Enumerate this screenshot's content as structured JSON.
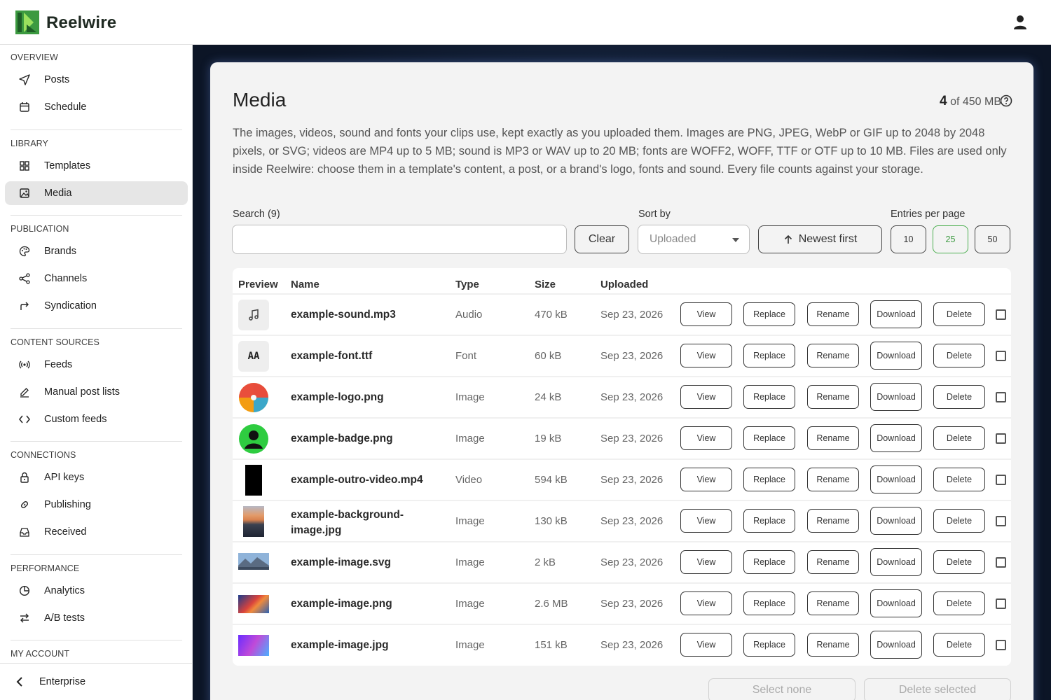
{
  "app": {
    "name": "Reelwire",
    "brand_color": "#3c9a40"
  },
  "header": {
    "user_icon": "user-icon"
  },
  "sidebar": {
    "sections": [
      {
        "title": "OVERVIEW",
        "items": [
          {
            "label": "Posts",
            "icon": "send-icon"
          },
          {
            "label": "Schedule",
            "icon": "calendar-icon"
          }
        ]
      },
      {
        "title": "LIBRARY",
        "items": [
          {
            "label": "Templates",
            "icon": "grid-icon"
          },
          {
            "label": "Media",
            "icon": "image-icon",
            "active": true
          }
        ]
      },
      {
        "title": "PUBLICATION",
        "items": [
          {
            "label": "Brands",
            "icon": "palette-icon"
          },
          {
            "label": "Channels",
            "icon": "share-icon"
          },
          {
            "label": "Syndication",
            "icon": "forward-arrow-icon"
          }
        ]
      },
      {
        "title": "CONTENT SOURCES",
        "items": [
          {
            "label": "Feeds",
            "icon": "broadcast-icon"
          },
          {
            "label": "Manual post lists",
            "icon": "pencil-icon"
          },
          {
            "label": "Custom feeds",
            "icon": "code-icon"
          }
        ]
      },
      {
        "title": "CONNECTIONS",
        "items": [
          {
            "label": "API keys",
            "icon": "lock-icon"
          },
          {
            "label": "Publishing",
            "icon": "link-icon"
          },
          {
            "label": "Received",
            "icon": "inbox-icon"
          }
        ]
      },
      {
        "title": "PERFORMANCE",
        "items": [
          {
            "label": "Analytics",
            "icon": "pie-chart-icon"
          },
          {
            "label": "A/B tests",
            "icon": "swap-icon"
          }
        ]
      },
      {
        "title": "MY ACCOUNT",
        "items": []
      }
    ],
    "bottom": {
      "label": "Enterprise",
      "icon": "chevron-left-icon"
    }
  },
  "main": {
    "title": "Media",
    "storage": {
      "used": "4",
      "rest": " of 450 MB"
    },
    "description": "The images, videos, sound and fonts your clips use, kept exactly as you uploaded them. Images are PNG, JPEG, WebP or GIF up to 2048 by 2048 pixels, or SVG; videos are MP4 up to 5 MB; sound is MP3 or WAV up to 20 MB; fonts are WOFF2, WOFF, TTF or OTF up to 10 MB. Files are used only inside Reelwire: choose them in a template's content, a post, or a brand's logo, fonts and sound. Every file counts against your storage.",
    "search": {
      "label": "Search (9)",
      "value": "",
      "placeholder": ""
    },
    "clear_label": "Clear",
    "sort": {
      "label": "Sort by",
      "selected": "Uploaded",
      "order_label": "Newest first"
    },
    "entries": {
      "label": "Entries per page",
      "options": [
        "10",
        "25",
        "50"
      ],
      "selected": "25"
    },
    "table": {
      "headers": {
        "preview": "Preview",
        "name": "Name",
        "type": "Type",
        "size": "Size",
        "uploaded": "Uploaded"
      },
      "actions": {
        "view": "View",
        "replace": "Replace",
        "rename": "Rename",
        "download": "Download",
        "delete": "Delete"
      },
      "rows": [
        {
          "name": "example-sound.mp3",
          "type": "Audio",
          "size": "470 kB",
          "uploaded": "Sep 23, 2026",
          "preview": "music-note-icon"
        },
        {
          "name": "example-font.ttf",
          "type": "Font",
          "size": "60 kB",
          "uploaded": "Sep 23, 2026",
          "preview": "font-icon",
          "preview_text": "AA"
        },
        {
          "name": "example-logo.png",
          "type": "Image",
          "size": "24 kB",
          "uploaded": "Sep 23, 2026",
          "preview": "beach-ball-image"
        },
        {
          "name": "example-badge.png",
          "type": "Image",
          "size": "19 kB",
          "uploaded": "Sep 23, 2026",
          "preview": "badge-image"
        },
        {
          "name": "example-outro-video.mp4",
          "type": "Video",
          "size": "594 kB",
          "uploaded": "Sep 23, 2026",
          "preview": "video-image"
        },
        {
          "name": "example-background-image.jpg",
          "type": "Image",
          "size": "130 kB",
          "uploaded": "Sep 23, 2026",
          "preview": "sunset-image"
        },
        {
          "name": "example-image.svg",
          "type": "Image",
          "size": "2 kB",
          "uploaded": "Sep 23, 2026",
          "preview": "mountain-image"
        },
        {
          "name": "example-image.png",
          "type": "Image",
          "size": "2.6 MB",
          "uploaded": "Sep 23, 2026",
          "preview": "abstract-image"
        },
        {
          "name": "example-image.jpg",
          "type": "Image",
          "size": "151 kB",
          "uploaded": "Sep 23, 2026",
          "preview": "gradient-image"
        }
      ]
    },
    "select_none_label": "Select none",
    "delete_selected_label": "Delete selected"
  }
}
